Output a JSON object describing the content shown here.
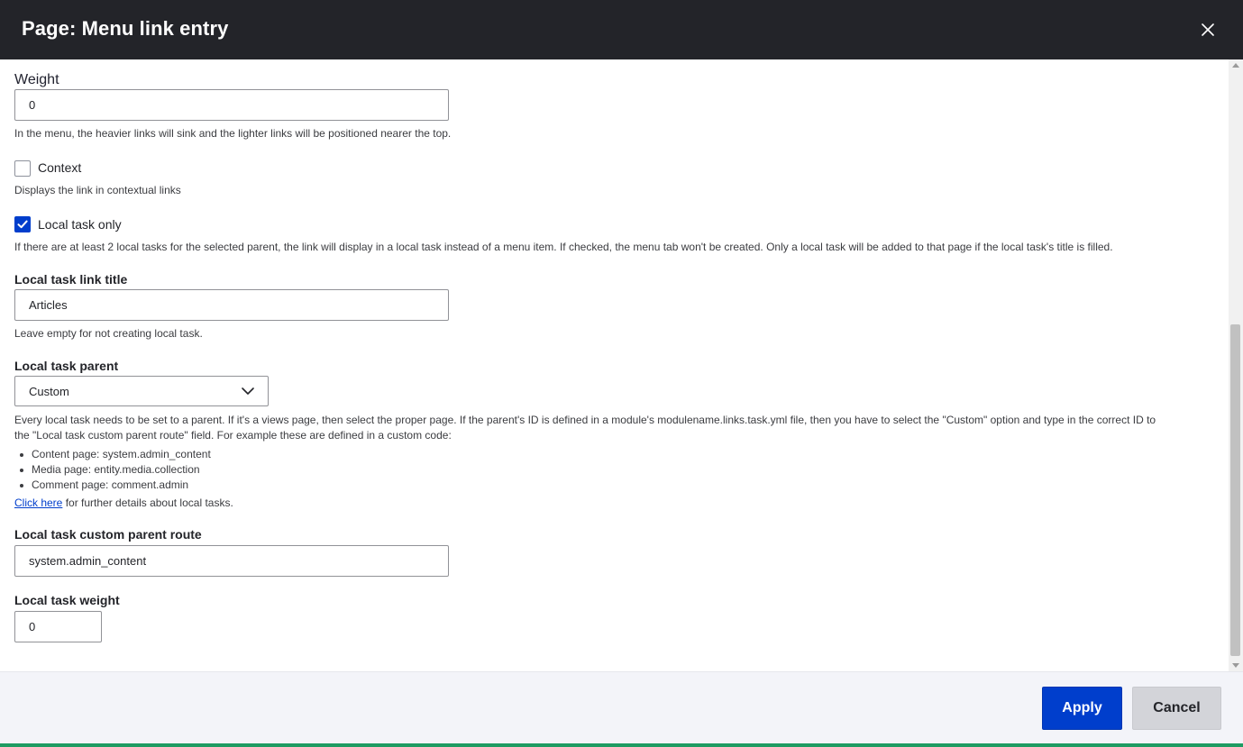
{
  "dialog": {
    "title": "Page: Menu link entry",
    "close_icon": "close-icon"
  },
  "form": {
    "weight": {
      "label": "Weight",
      "value": "0",
      "description": "In the menu, the heavier links will sink and the lighter links will be positioned nearer the top."
    },
    "context": {
      "label": "Context",
      "checked": false,
      "description": "Displays the link in contextual links"
    },
    "local_task_only": {
      "label": "Local task only",
      "checked": true,
      "description": "If there are at least 2 local tasks for the selected parent, the link will display in a local task instead of a menu item. If checked, the menu tab won't be created. Only a local task will be added to that page if the local task's title is filled."
    },
    "local_task_title": {
      "label": "Local task link title",
      "value": "Articles",
      "description": "Leave empty for not creating local task."
    },
    "local_task_parent": {
      "label": "Local task parent",
      "selected": "Custom",
      "description_line1": "Every local task needs to be set to a parent. If it's a views page, then select the proper page. If the parent's ID is defined in a module's modulename.links.task.yml file, then you have to select the \"Custom\" option and type in the correct ID to",
      "description_line2": "the \"Local task custom parent route\" field. For example these are defined in a custom code:",
      "examples": [
        "Content page: system.admin_content",
        "Media page: entity.media.collection",
        "Comment page: comment.admin"
      ],
      "link_text": "Click here",
      "link_suffix": " for further details about local tasks."
    },
    "custom_parent_route": {
      "label": "Local task custom parent route",
      "value": "system.admin_content"
    },
    "local_task_weight": {
      "label": "Local task weight",
      "value": "0"
    }
  },
  "footer": {
    "apply_label": "Apply",
    "cancel_label": "Cancel"
  },
  "colors": {
    "header_bg": "#232429",
    "primary": "#003ecc",
    "footer_bg": "#f3f4f9"
  }
}
